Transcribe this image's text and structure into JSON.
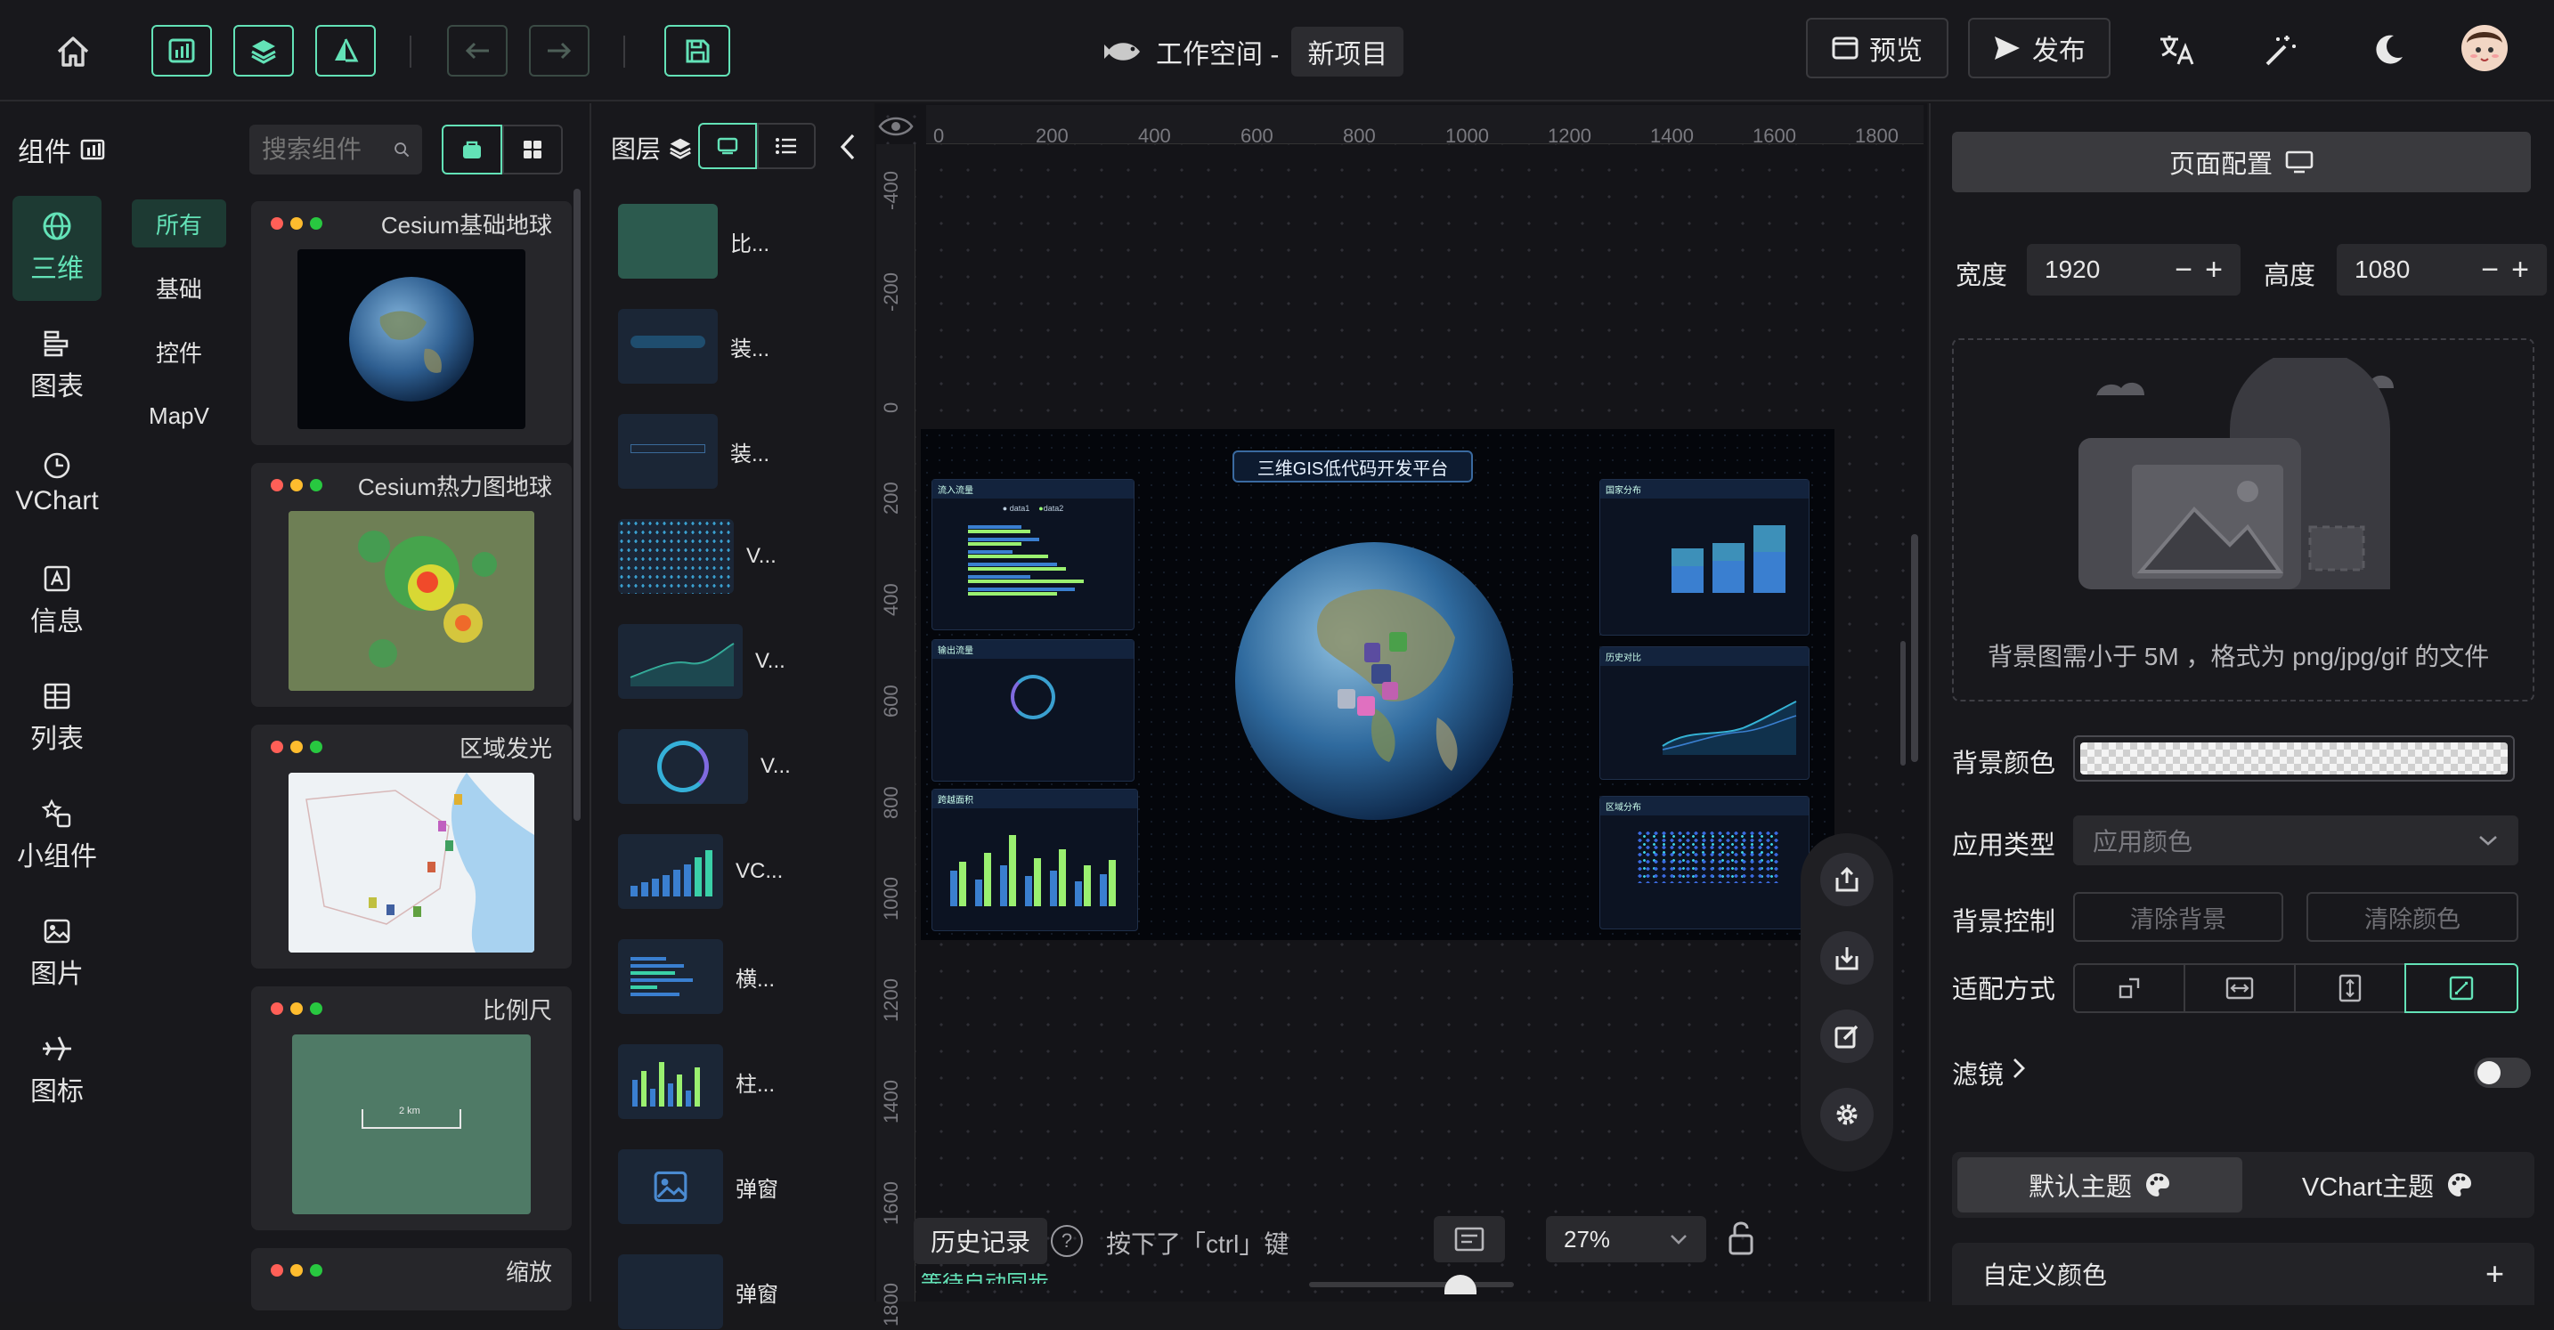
{
  "header": {
    "workspace": "工作空间 -",
    "project": "新项目",
    "preview": "预览",
    "publish": "发布"
  },
  "components_panel": {
    "title": "组件",
    "search_placeholder": "搜索组件",
    "categories": [
      {
        "label": "三维",
        "icon": "globe-icon",
        "active": true
      },
      {
        "label": "图表",
        "icon": "chart-icon"
      },
      {
        "label": "VChart",
        "icon": "clock-icon"
      },
      {
        "label": "信息",
        "icon": "info-icon"
      },
      {
        "label": "列表",
        "icon": "table-icon"
      },
      {
        "label": "小组件",
        "icon": "widget-icon"
      },
      {
        "label": "图片",
        "icon": "image-icon"
      },
      {
        "label": "图标",
        "icon": "plane-icon"
      }
    ],
    "subcategories": [
      "所有",
      "基础",
      "控件",
      "MapV"
    ],
    "cards": [
      {
        "title": "Cesium基础地球"
      },
      {
        "title": "Cesium热力图地球"
      },
      {
        "title": "区域发光"
      },
      {
        "title": "比例尺",
        "scale_label": "2 km"
      },
      {
        "title": "缩放"
      }
    ]
  },
  "layers_panel": {
    "title": "图层",
    "items": [
      "比...",
      "装...",
      "装...",
      "V...",
      "V...",
      "V...",
      "VC...",
      "横...",
      "柱...",
      "弹窗",
      "弹窗"
    ]
  },
  "canvas": {
    "ruler_h": [
      "0",
      "200",
      "400",
      "600",
      "800",
      "1000",
      "1200",
      "1400",
      "1600",
      "1800"
    ],
    "ruler_v": [
      "-400",
      "-200",
      "0",
      "200",
      "400",
      "600",
      "800",
      "1000",
      "1200",
      "1400",
      "1600",
      "1800"
    ],
    "dashboard_title": "三维GIS低代码开发平台",
    "panels": {
      "inflow": "流入流量",
      "outflow": "输出流量",
      "daily": "跨越面积",
      "country": "国家分布",
      "history": "历史对比",
      "region": "区域分布"
    },
    "legend_data1": "data1",
    "legend_data2": "data2",
    "history_btn": "历史记录",
    "hint": "按下了「ctrl」键",
    "zoom": "27%",
    "sync_text": "等待自动同步"
  },
  "right_panel": {
    "page_config": "页面配置",
    "width_label": "宽度",
    "width_value": "1920",
    "height_label": "高度",
    "height_value": "1080",
    "bg_hint": "背景图需小于 5M ，格式为 png/jpg/gif 的文件",
    "bg_color_label": "背景颜色",
    "app_type_label": "应用类型",
    "app_type_value": "应用颜色",
    "bg_control_label": "背景控制",
    "clear_bg": "清除背景",
    "clear_color": "清除颜色",
    "fit_label": "适配方式",
    "filter_label": "滤镜",
    "default_theme": "默认主题",
    "vchart_theme": "VChart主题",
    "custom_color": "自定义颜色"
  },
  "colors": {
    "accent": "#63e2b7",
    "bg": "#18181c"
  }
}
